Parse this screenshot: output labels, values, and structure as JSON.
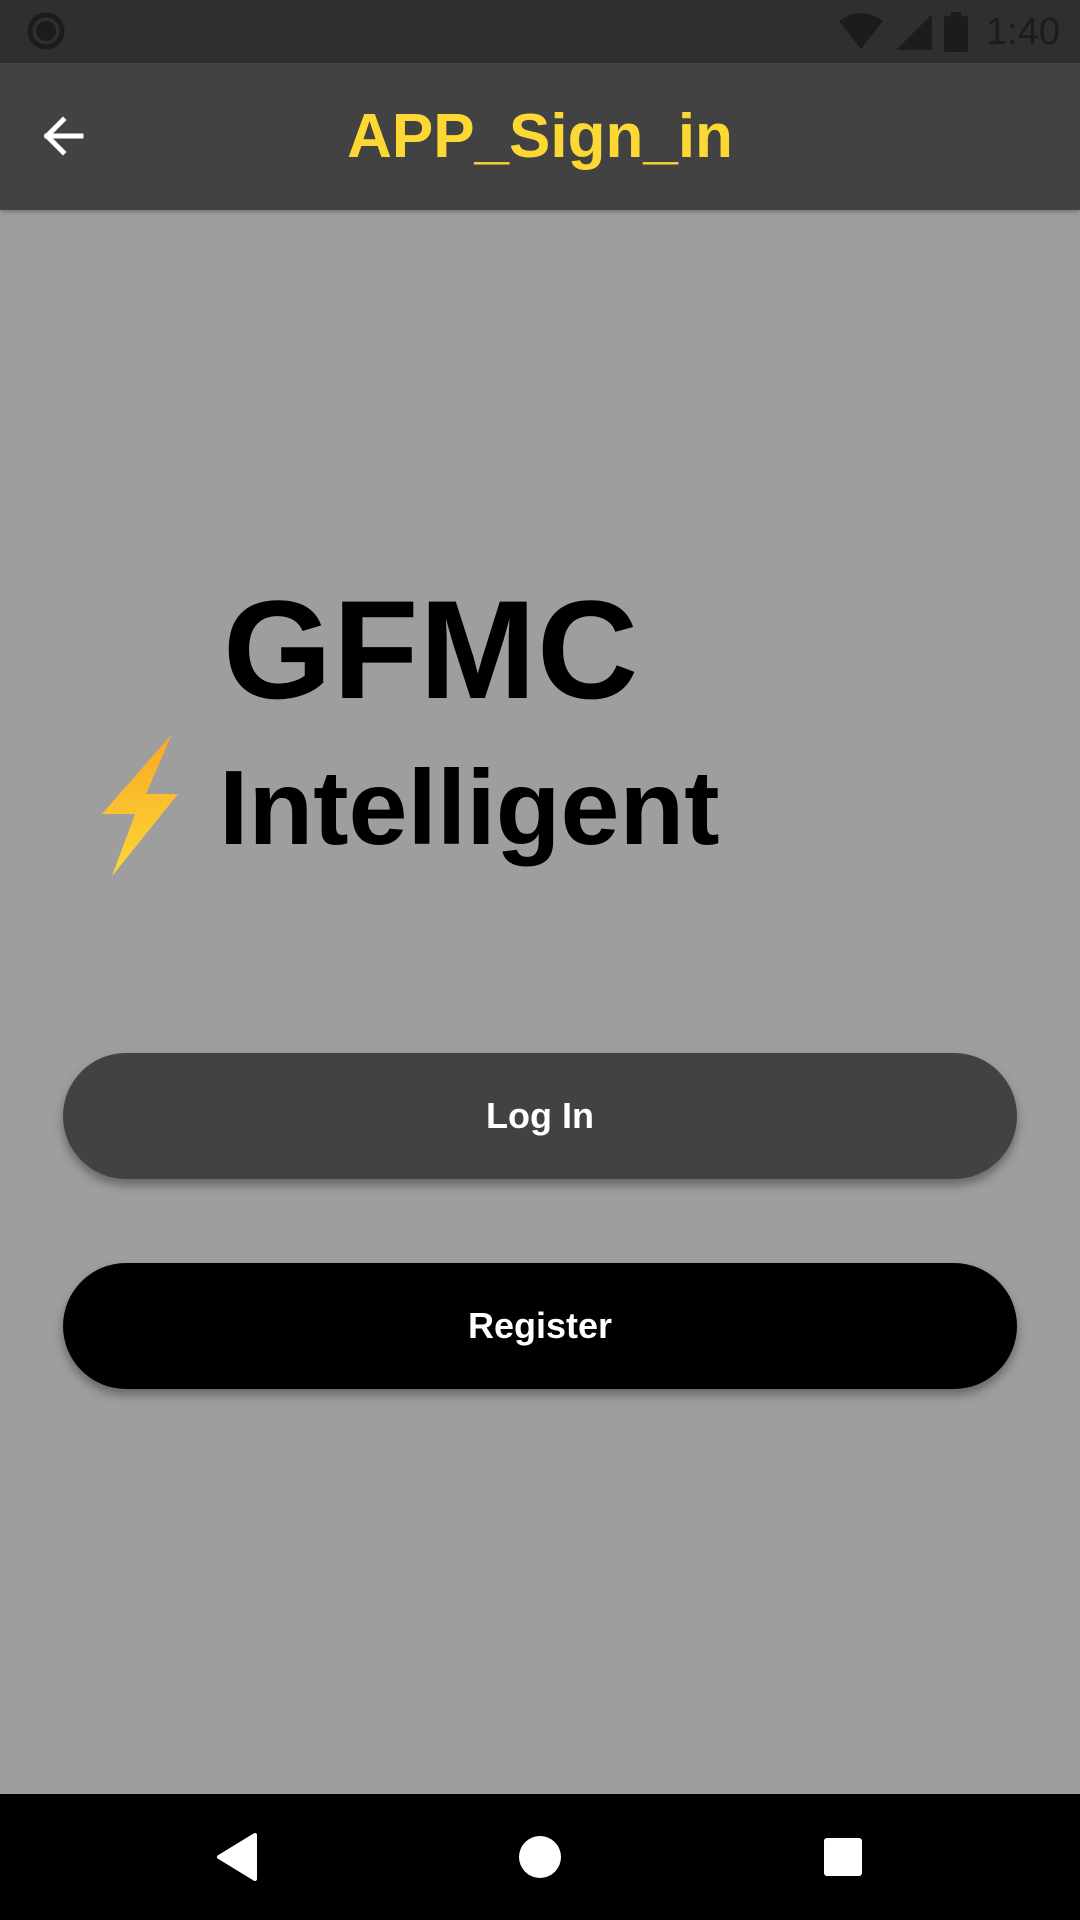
{
  "status_bar": {
    "time": "1:40",
    "icons": [
      "circle-icon",
      "wifi-icon",
      "signal-icon",
      "battery-icon"
    ]
  },
  "app_bar": {
    "title": "APP_Sign_in",
    "back_icon": "arrow-back-icon",
    "title_color": "#fdd835",
    "background": "#424242"
  },
  "logo": {
    "line1": "GFMC",
    "line2": "Intelligent",
    "icon": "lightning-bolt-icon",
    "icon_color": "#f9a825"
  },
  "buttons": {
    "login_label": "Log In",
    "register_label": "Register"
  },
  "nav_bar": {
    "icons": [
      "triangle-back-icon",
      "circle-home-icon",
      "square-recents-icon"
    ]
  },
  "colors": {
    "page_background": "#9e9e9e",
    "status_bar": "#2f2f2f",
    "login_button": "#424242",
    "register_button": "#000000"
  }
}
